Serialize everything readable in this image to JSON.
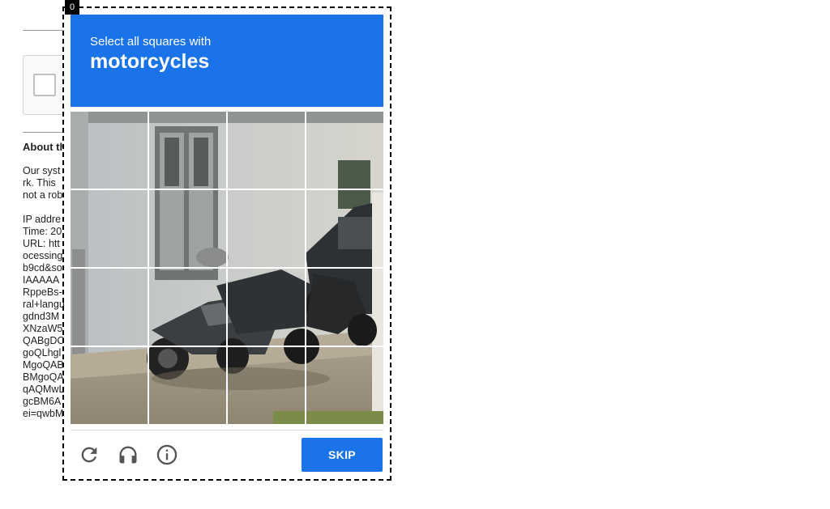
{
  "counter": "0",
  "challenge": {
    "instruction": "Select all squares with",
    "target": "motorcycles"
  },
  "grid": {
    "rows": 4,
    "cols": 4,
    "tiles": [
      "tile-1",
      "tile-2",
      "tile-3",
      "tile-4",
      "tile-5",
      "tile-6",
      "tile-7",
      "tile-8",
      "tile-9",
      "tile-10",
      "tile-11",
      "tile-12",
      "tile-13",
      "tile-14",
      "tile-15",
      "tile-16"
    ]
  },
  "footer": {
    "reload_icon": "reload-icon",
    "audio_icon": "headphones-icon",
    "info_icon": "info-icon",
    "skip_label": "SKIP"
  },
  "background_page": {
    "about_title": "About th",
    "lines": [
      "Our syst",
      "rk. This",
      "not a rob",
      "",
      "IP addre",
      "Time: 20",
      "URL: htt",
      "ocessing",
      "b9cd&so",
      "IAAAAA",
      "RppeBs-",
      "ral+langu",
      "gdnd3M",
      "XNzaW5",
      "QABgDC",
      "goQLhgl",
      "MgoQAB",
      "BMgoQA",
      "qAQMwL",
      "gcBM6A",
      "ei=qwbM"
    ]
  },
  "colors": {
    "accent": "#1a73e8",
    "frame_border": "#000000"
  }
}
